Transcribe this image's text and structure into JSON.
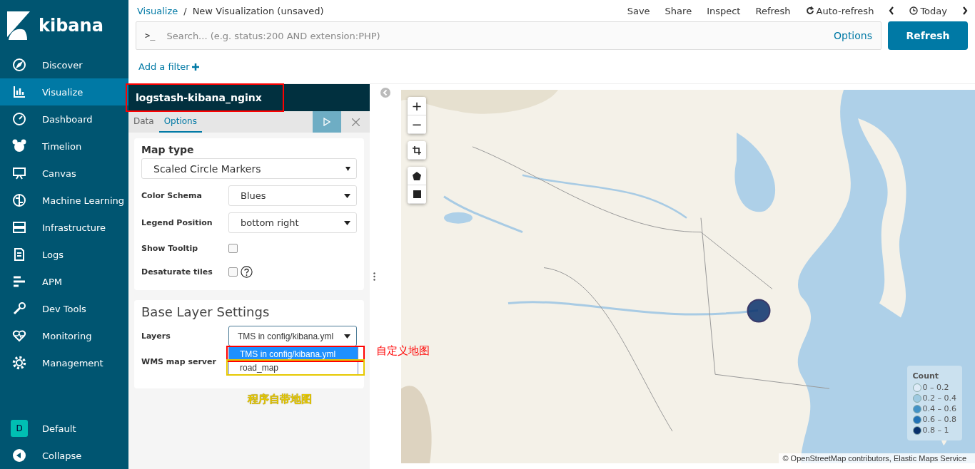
{
  "sidebar": {
    "logo": "kibana",
    "items": [
      {
        "label": "Discover",
        "selected": false
      },
      {
        "label": "Visualize",
        "selected": true
      },
      {
        "label": "Dashboard",
        "selected": false
      },
      {
        "label": "Timelion",
        "selected": false
      },
      {
        "label": "Canvas",
        "selected": false
      },
      {
        "label": "Machine Learning",
        "selected": false
      },
      {
        "label": "Infrastructure",
        "selected": false
      },
      {
        "label": "Logs",
        "selected": false
      },
      {
        "label": "APM",
        "selected": false
      },
      {
        "label": "Dev Tools",
        "selected": false
      },
      {
        "label": "Monitoring",
        "selected": false
      },
      {
        "label": "Management",
        "selected": false
      }
    ],
    "space": {
      "initial": "D",
      "label": "Default"
    },
    "collapse": "Collapse"
  },
  "breadcrumb": {
    "parent": "Visualize",
    "separator": "/",
    "current": "New Visualization (unsaved)"
  },
  "top_menu": [
    "Save",
    "Share",
    "Inspect",
    "Refresh"
  ],
  "auto_refresh": "Auto-refresh",
  "time": "Today",
  "query": {
    "prompt": ">_",
    "placeholder": "Search... (e.g. status:200 AND extension:PHP)",
    "options": "Options"
  },
  "refresh_button": "Refresh",
  "add_filter": "Add a filter",
  "editor": {
    "index_pattern": "logstash-kibana_nginx",
    "tabs": [
      {
        "label": "Data",
        "selected": false
      },
      {
        "label": "Options",
        "selected": true
      }
    ]
  },
  "options_panel": {
    "map_type_label": "Map type",
    "map_type_value": "Scaled Circle Markers",
    "fields": [
      {
        "kind": "select",
        "label": "Color Schema",
        "value": "Blues"
      },
      {
        "kind": "select",
        "label": "Legend Position",
        "value": "bottom right"
      },
      {
        "kind": "checkbox",
        "label": "Show Tooltip",
        "checked": false
      },
      {
        "kind": "checkbox",
        "label": "Desaturate tiles",
        "checked": false,
        "help": true
      }
    ]
  },
  "base_layer": {
    "title": "Base Layer Settings",
    "layers_label": "Layers",
    "layers_value": "TMS in config/kibana.yml",
    "wms_label": "WMS map server",
    "dropdown_options": [
      {
        "label": "TMS in config/kibana.yml",
        "selected": true
      },
      {
        "label": "road_map",
        "selected": false
      }
    ]
  },
  "annotations": [
    {
      "text": "自定义地图",
      "color": "#ff0000"
    },
    {
      "text": "程序自带地图",
      "color": "#e6c800"
    }
  ],
  "map": {
    "zoom_in": "+",
    "zoom_out": "−",
    "attribution": "© OpenStreetMap contributors, Elastic Maps Service",
    "legend": {
      "title": "Count",
      "items": [
        {
          "label": "0 – 0.2",
          "color": "#deebf7"
        },
        {
          "label": "0.2 – 0.4",
          "color": "#9ecae1"
        },
        {
          "label": "0.4 – 0.6",
          "color": "#4292c6"
        },
        {
          "label": "0.6 – 0.8",
          "color": "#2171b5"
        },
        {
          "label": "0.8 – 1",
          "color": "#08306b"
        }
      ]
    }
  }
}
